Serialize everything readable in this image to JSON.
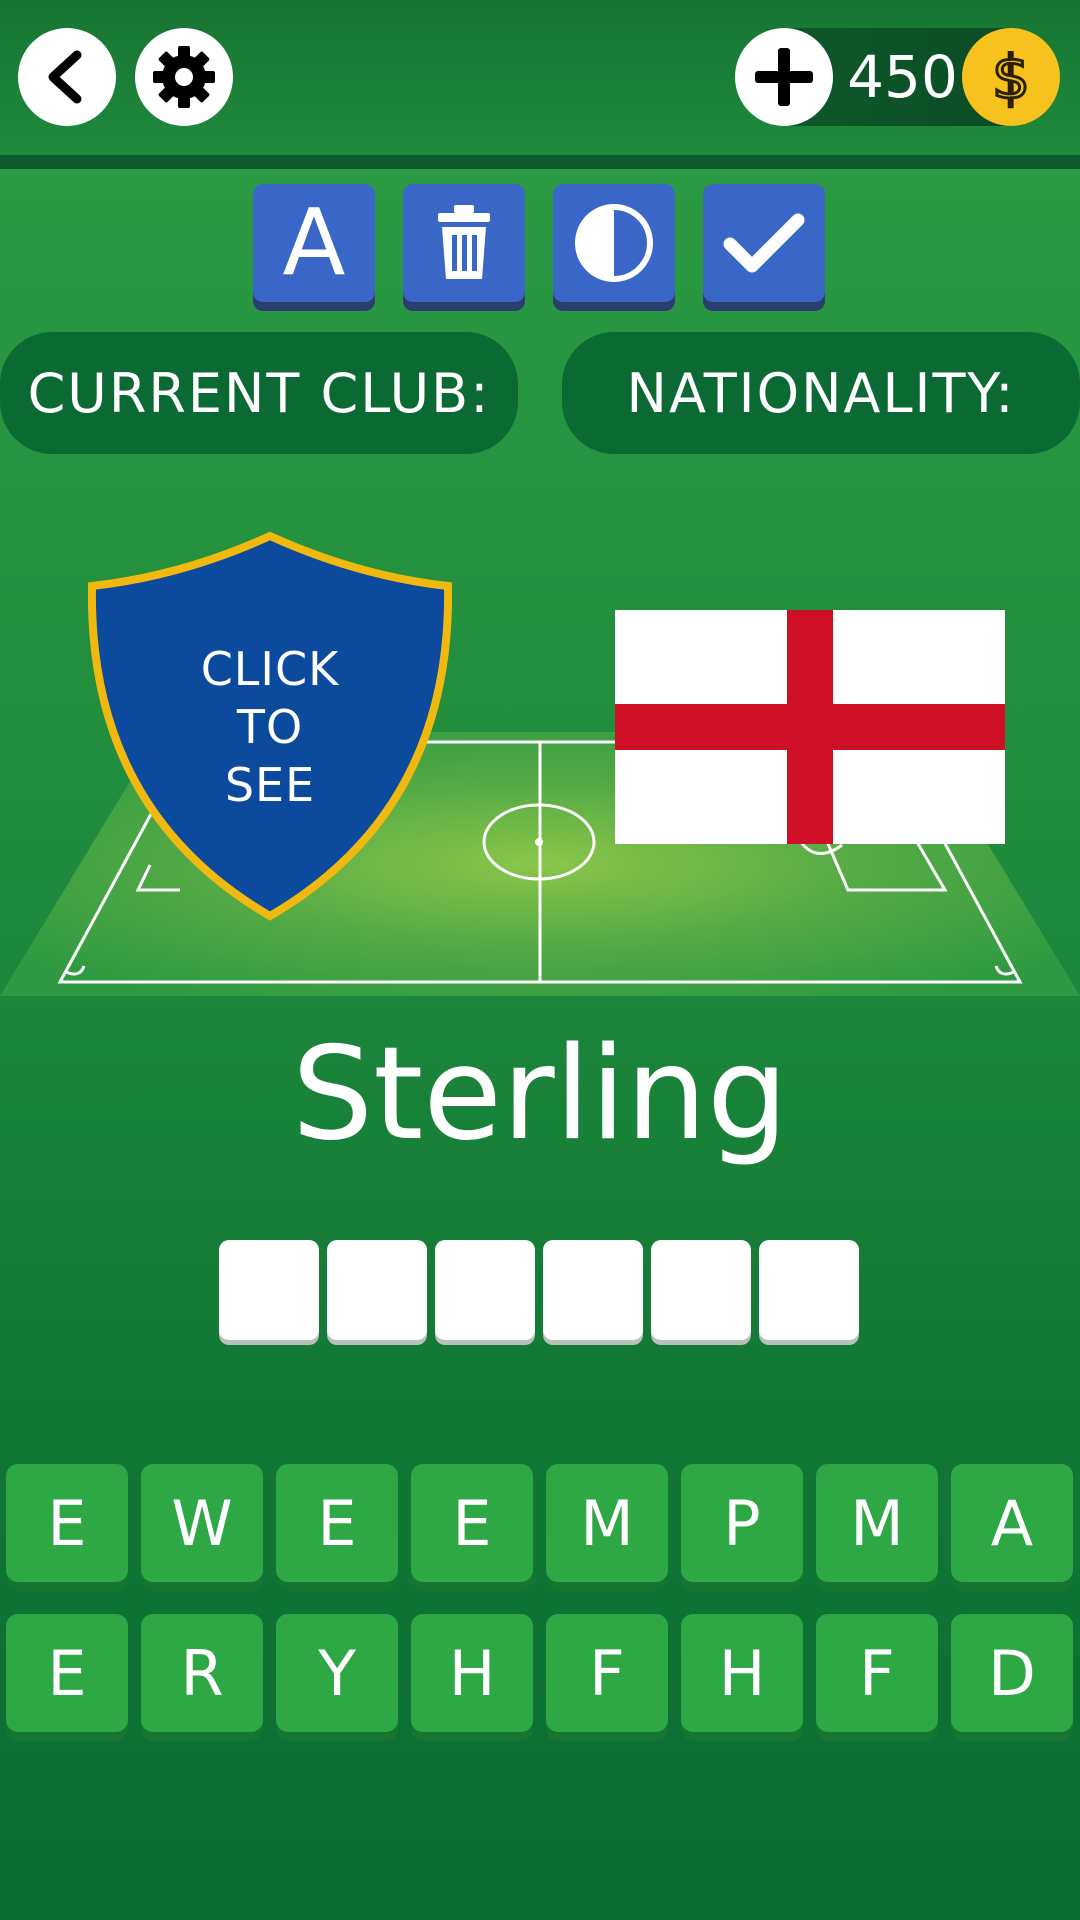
{
  "topbar": {
    "back_icon": "chevron-left-icon",
    "settings_icon": "gear-icon",
    "add_coins_icon": "plus-icon",
    "coins": "450",
    "coin_icon": "dollar-coin-icon"
  },
  "hints": [
    {
      "icon": "letter-a-icon",
      "label": "A"
    },
    {
      "icon": "trash-icon",
      "label": ""
    },
    {
      "icon": "half-circle-icon",
      "label": ""
    },
    {
      "icon": "checkmark-icon",
      "label": ""
    }
  ],
  "info": {
    "club_label": "CURRENT CLUB:",
    "nationality_label": "NATIONALITY:"
  },
  "badge": {
    "line1": "CLICK",
    "line2": "TO",
    "line3": "SEE"
  },
  "flag": "england-flag",
  "player_name": "Sterling",
  "answer_slot_count": 6,
  "keyboard": {
    "row1": [
      "E",
      "W",
      "E",
      "E",
      "M",
      "P",
      "M",
      "A"
    ],
    "row2": [
      "E",
      "R",
      "Y",
      "H",
      "F",
      "H",
      "F",
      "D"
    ]
  },
  "colors": {
    "background": "#1f8a3c",
    "hint_button": "#3a67c7",
    "key": "#2ea845",
    "shield": "#0b4a9c",
    "shield_border": "#f1b90f",
    "coin": "#f7c21e",
    "flag_red": "#cf0f25"
  }
}
